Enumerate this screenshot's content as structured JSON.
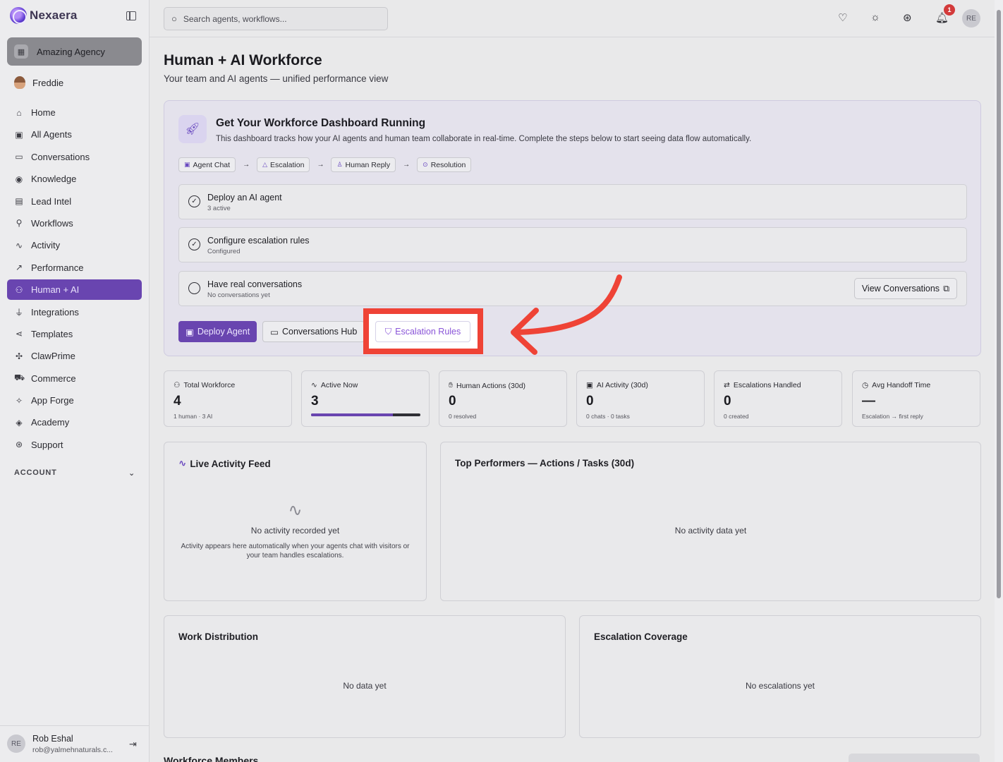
{
  "sidebar": {
    "brand": "Nexaera",
    "agency": "Amazing Agency",
    "user": "Freddie",
    "items": [
      {
        "label": "Home",
        "icon": "home-icon",
        "glyph": "⌂"
      },
      {
        "label": "All Agents",
        "icon": "bot-icon",
        "glyph": "▣"
      },
      {
        "label": "Conversations",
        "icon": "message-icon",
        "glyph": "▭"
      },
      {
        "label": "Knowledge",
        "icon": "brain-icon",
        "glyph": "◉"
      },
      {
        "label": "Lead Intel",
        "icon": "contact-icon",
        "glyph": "▤"
      },
      {
        "label": "Workflows",
        "icon": "workflow-icon",
        "glyph": "⚲"
      },
      {
        "label": "Activity",
        "icon": "activity-icon",
        "glyph": "∿"
      },
      {
        "label": "Performance",
        "icon": "trending-icon",
        "glyph": "↗"
      },
      {
        "label": "Human + AI",
        "icon": "network-icon",
        "glyph": "⚇",
        "active": true
      },
      {
        "label": "Integrations",
        "icon": "plug-icon",
        "glyph": "⏚"
      },
      {
        "label": "Templates",
        "icon": "share-icon",
        "glyph": "⋖"
      },
      {
        "label": "ClawPrime",
        "icon": "paw-icon",
        "glyph": "✣"
      },
      {
        "label": "Commerce",
        "icon": "cart-icon",
        "glyph": "⛟"
      },
      {
        "label": "App Forge",
        "icon": "sparkles-icon",
        "glyph": "✧"
      },
      {
        "label": "Academy",
        "icon": "graduation-icon",
        "glyph": "◈"
      },
      {
        "label": "Support",
        "icon": "lifebuoy-icon",
        "glyph": "⊛"
      }
    ],
    "account_label": "ACCOUNT",
    "footer": {
      "initials": "RE",
      "name": "Rob Eshal",
      "email": "rob@yalmehnaturals.c..."
    }
  },
  "topbar": {
    "search_placeholder": "Search agents, workflows...",
    "notification_count": "1",
    "avatar_initials": "RE"
  },
  "page": {
    "title": "Human + AI Workforce",
    "subtitle": "Your team and AI agents — unified performance view"
  },
  "setup": {
    "title": "Get Your Workforce Dashboard Running",
    "description": "This dashboard tracks how your AI agents and human team collaborate in real-time. Complete the steps below to start seeing data flow automatically.",
    "flow": [
      "Agent Chat",
      "Escalation",
      "Human Reply",
      "Resolution"
    ],
    "steps": [
      {
        "label": "Deploy an AI agent",
        "sub": "3 active",
        "done": true
      },
      {
        "label": "Configure escalation rules",
        "sub": "Configured",
        "done": true
      },
      {
        "label": "Have real conversations",
        "sub": "No conversations yet",
        "done": false
      }
    ],
    "view_conversations": "View Conversations",
    "deploy_agent": "Deploy Agent",
    "conversations_hub": "Conversations Hub",
    "escalation_rules": "Escalation Rules"
  },
  "stats": [
    {
      "label": "Total Workforce",
      "value": "4",
      "sub": "1 human · 3 AI"
    },
    {
      "label": "Active Now",
      "value": "3",
      "progress": 0.75
    },
    {
      "label": "Human Actions (30d)",
      "value": "0",
      "sub": "0 resolved"
    },
    {
      "label": "AI Activity (30d)",
      "value": "0",
      "sub": "0 chats · 0 tasks"
    },
    {
      "label": "Escalations Handled",
      "value": "0",
      "sub": "0 created"
    },
    {
      "label": "Avg Handoff Time",
      "value": "—",
      "sub": "Escalation → first reply"
    }
  ],
  "panels": {
    "live_feed": {
      "title": "Live Activity Feed",
      "empty": "No activity recorded yet",
      "hint": "Activity appears here automatically when your agents chat with visitors or your team handles escalations."
    },
    "top_performers": {
      "title": "Top Performers — Actions / Tasks (30d)",
      "empty": "No activity data yet"
    },
    "work_distribution": {
      "title": "Work Distribution",
      "empty": "No data yet"
    },
    "escalation_coverage": {
      "title": "Escalation Coverage",
      "empty": "No escalations yet"
    }
  },
  "members_title": "Workforce Members",
  "colors": {
    "accent": "#6945b0",
    "highlight": "#ef4336"
  }
}
